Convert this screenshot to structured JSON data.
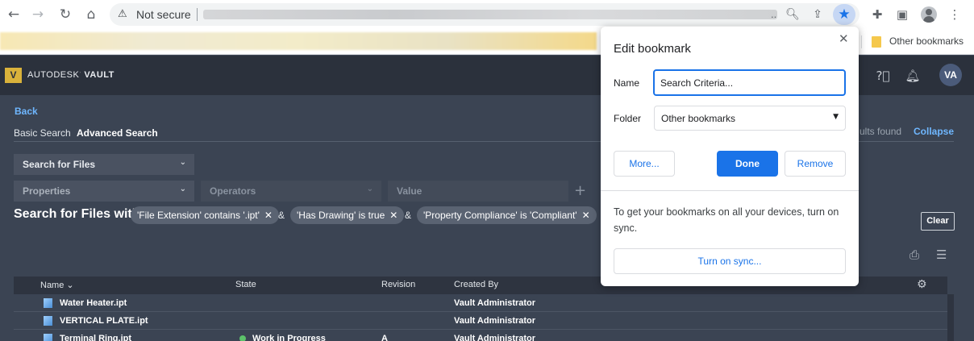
{
  "browser": {
    "security_label": "Not secure",
    "url_ellipsis": "..",
    "other_bookmarks": "Other bookmarks"
  },
  "app": {
    "logo_letter": "V",
    "brand_prefix": "AUTODESK",
    "brand_name": "VAULT",
    "user_initials": "VA"
  },
  "search": {
    "back": "Back",
    "tabs": [
      "Basic Search",
      "Advanced Search"
    ],
    "results_suffix": "ults found",
    "collapse": "Collapse",
    "scope": "Search for Files",
    "properties_placeholder": "Properties",
    "operators_placeholder": "Operators",
    "value_placeholder": "Value",
    "criteria_heading": "Search for Files with",
    "criteria": [
      "'File Extension' contains '.ipt'",
      "'Has Drawing' is true",
      "'Property Compliance' is 'Compliant'"
    ],
    "joiner": "&",
    "clear": "Clear"
  },
  "table": {
    "columns": [
      "Name",
      "State",
      "Revision",
      "Created By"
    ],
    "rows": [
      {
        "name": "Water Heater.ipt",
        "state": "",
        "revision": "",
        "created_by": "Vault Administrator"
      },
      {
        "name": "VERTICAL PLATE.ipt",
        "state": "",
        "revision": "",
        "created_by": "Vault Administrator"
      },
      {
        "name": "Terminal Ring.ipt",
        "state": "Work in Progress",
        "revision": "A",
        "created_by": "Vault Administrator"
      }
    ]
  },
  "bookmark_dialog": {
    "title": "Edit bookmark",
    "name_label": "Name",
    "name_value": "Search Criteria...",
    "folder_label": "Folder",
    "folder_value": "Other bookmarks",
    "more": "More...",
    "done": "Done",
    "remove": "Remove",
    "sync_message": "To get your bookmarks on all your devices, turn on sync.",
    "sync_button": "Turn on sync..."
  }
}
